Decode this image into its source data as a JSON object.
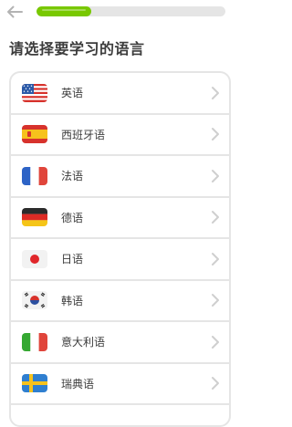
{
  "header": {
    "back_icon": "arrow-left-icon",
    "progress": 0.29,
    "progress_color": "#78c800",
    "track_color": "#e5e5e5"
  },
  "title": "请选择要学习的语言",
  "languages": [
    {
      "label": "英语",
      "flag": "us-flag-icon"
    },
    {
      "label": "西班牙语",
      "flag": "spain-flag-icon"
    },
    {
      "label": "法语",
      "flag": "france-flag-icon"
    },
    {
      "label": "德语",
      "flag": "germany-flag-icon"
    },
    {
      "label": "日语",
      "flag": "japan-flag-icon"
    },
    {
      "label": "韩语",
      "flag": "korea-flag-icon"
    },
    {
      "label": "意大利语",
      "flag": "italy-flag-icon"
    },
    {
      "label": "瑞典语",
      "flag": "sweden-flag-icon"
    }
  ]
}
